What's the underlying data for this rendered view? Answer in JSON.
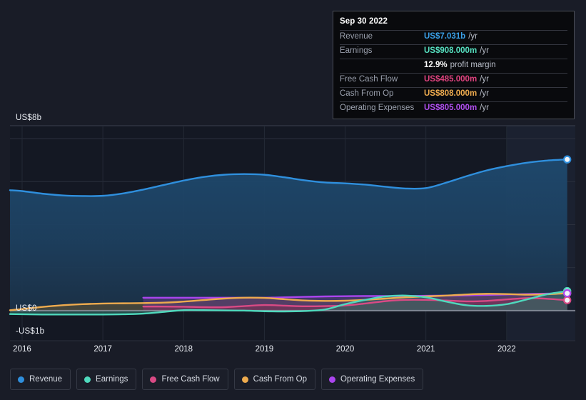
{
  "theme": {
    "background": "#191c27",
    "plot_background": "#141823",
    "highlight_band": "#1b2130",
    "gridline": "#2b303d",
    "zero_line": "#9aa0ad",
    "text": "#e9ecf2",
    "muted_text": "#9aa0ad",
    "tooltip_bg": "#090a0d",
    "tooltip_border": "#4a4d57"
  },
  "tooltip": {
    "title": "Sep 30 2022",
    "rows": [
      {
        "label": "Revenue",
        "value": "US$7.031b",
        "suffix": "/yr",
        "color": "#3aa0e8"
      },
      {
        "label": "Earnings",
        "value": "US$908.000m",
        "suffix": "/yr",
        "color": "#56e0c0"
      },
      {
        "label": "",
        "value": "12.9%",
        "suffix": "profit margin",
        "color": "#ffffff"
      },
      {
        "label": "Free Cash Flow",
        "value": "US$485.000m",
        "suffix": "/yr",
        "color": "#e0437f"
      },
      {
        "label": "Cash From Op",
        "value": "US$808.000m",
        "suffix": "/yr",
        "color": "#eeab4e"
      },
      {
        "label": "Operating Expenses",
        "value": "US$805.000m",
        "suffix": "/yr",
        "color": "#b14ff0"
      }
    ]
  },
  "legend": {
    "items": [
      {
        "label": "Revenue",
        "color": "#2f8fdd"
      },
      {
        "label": "Earnings",
        "color": "#4fd9bd"
      },
      {
        "label": "Free Cash Flow",
        "color": "#d94a85"
      },
      {
        "label": "Cash From Op",
        "color": "#eeab4e"
      },
      {
        "label": "Operating Expenses",
        "color": "#ab45ef"
      }
    ]
  },
  "axes": {
    "y_labels": [
      {
        "text": "US$8b",
        "value": 8
      },
      {
        "text": "US$0",
        "value": 0
      },
      {
        "text": "-US$1b",
        "value": -1
      }
    ],
    "x_labels": [
      "2016",
      "2017",
      "2018",
      "2019",
      "2020",
      "2021",
      "2022"
    ]
  },
  "chart_data": {
    "type": "area",
    "title": "",
    "xlabel": "",
    "ylabel": "",
    "currency": "USD",
    "units": "billions",
    "x": [
      2015.85,
      2016.0,
      2016.25,
      2016.5,
      2016.75,
      2017.0,
      2017.25,
      2017.5,
      2017.75,
      2018.0,
      2018.25,
      2018.5,
      2018.75,
      2019.0,
      2019.25,
      2019.5,
      2019.75,
      2020.0,
      2020.25,
      2020.5,
      2020.75,
      2021.0,
      2021.25,
      2021.5,
      2021.75,
      2022.0,
      2022.25,
      2022.5,
      2022.75
    ],
    "x_tick_values": [
      2016,
      2017,
      2018,
      2019,
      2020,
      2021,
      2022
    ],
    "ylim": [
      -1.4,
      8.6
    ],
    "yticks": [
      8,
      6,
      4,
      2,
      0
    ],
    "grid": true,
    "legend_position": "bottom",
    "highlight_band": {
      "from": 2022.0,
      "to": 2022.85,
      "label": ""
    },
    "annotations": [
      {
        "x": 2022.75,
        "label": "Sep 30 2022",
        "type": "endpoint-markers"
      }
    ],
    "series": [
      {
        "name": "Revenue",
        "color": "#2f8fdd",
        "fill": "#1d3d5c",
        "values": [
          5.6,
          5.56,
          5.44,
          5.36,
          5.33,
          5.34,
          5.45,
          5.63,
          5.84,
          6.05,
          6.22,
          6.32,
          6.35,
          6.32,
          6.2,
          6.06,
          5.96,
          5.92,
          5.86,
          5.76,
          5.68,
          5.7,
          5.95,
          6.25,
          6.52,
          6.72,
          6.88,
          6.98,
          7.031
        ],
        "last_value": 7.031,
        "last_value_label": "US$7.031b"
      },
      {
        "name": "Earnings",
        "color": "#4fd9bd",
        "fill": "#2e6b62",
        "values": [
          -0.16,
          -0.17,
          -0.18,
          -0.18,
          -0.18,
          -0.18,
          -0.17,
          -0.14,
          -0.06,
          0.02,
          0.02,
          0.01,
          0.0,
          -0.03,
          -0.04,
          -0.02,
          0.05,
          0.3,
          0.5,
          0.66,
          0.7,
          0.62,
          0.42,
          0.25,
          0.22,
          0.3,
          0.52,
          0.76,
          0.908
        ],
        "last_value": 0.908,
        "last_value_label": "US$908.000m"
      },
      {
        "name": "Free Cash Flow",
        "color": "#d94a85",
        "fill": "#7a3255",
        "values": [
          null,
          null,
          null,
          null,
          null,
          null,
          null,
          0.19,
          0.19,
          0.18,
          0.16,
          0.16,
          0.21,
          0.26,
          0.23,
          0.2,
          0.21,
          0.24,
          0.33,
          0.44,
          0.5,
          0.5,
          0.47,
          0.43,
          0.45,
          0.52,
          0.58,
          0.55,
          0.485
        ],
        "last_value": 0.485,
        "last_value_label": "US$485.000m"
      },
      {
        "name": "Cash From Op",
        "color": "#eeab4e",
        "fill": "#5d5336",
        "values": [
          0.02,
          0.07,
          0.17,
          0.25,
          0.3,
          0.33,
          0.34,
          0.35,
          0.37,
          0.42,
          0.49,
          0.56,
          0.6,
          0.59,
          0.53,
          0.47,
          0.45,
          0.46,
          0.5,
          0.56,
          0.62,
          0.66,
          0.7,
          0.75,
          0.78,
          0.77,
          0.74,
          0.76,
          0.808
        ],
        "last_value": 0.808,
        "last_value_label": "US$808.000m"
      },
      {
        "name": "Operating Expenses",
        "color": "#ab45ef",
        "fill": "#5c3a80",
        "values": [
          null,
          null,
          null,
          null,
          null,
          null,
          null,
          0.6,
          0.6,
          0.6,
          0.6,
          0.6,
          0.6,
          0.6,
          0.62,
          0.64,
          0.66,
          0.67,
          0.68,
          0.68,
          0.68,
          0.69,
          0.7,
          0.71,
          0.73,
          0.75,
          0.77,
          0.79,
          0.805
        ],
        "last_value": 0.805,
        "last_value_label": "US$805.000m"
      }
    ]
  }
}
